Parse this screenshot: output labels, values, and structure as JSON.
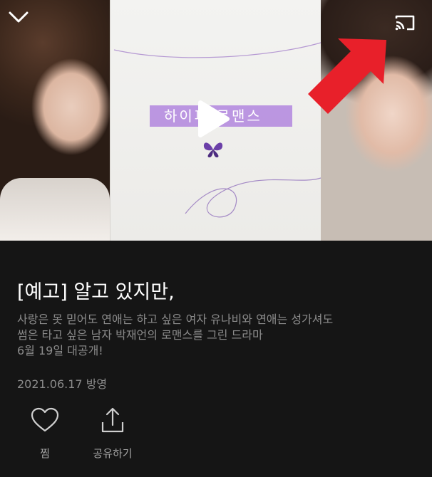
{
  "video": {
    "thumbnail_logo_text": "하이퍼 로맨스",
    "icons": {
      "collapse": "chevron-down-icon",
      "cast": "cast-icon",
      "play": "play-icon",
      "annotation": "red-arrow-icon"
    },
    "annotation_color": "#e8202a"
  },
  "info": {
    "title": "[예고] 알고 있지만,",
    "description_lines": [
      "사랑은 못 믿어도 연애는 하고 싶은 여자 유나비와 연애는 성가셔도",
      "썸은 타고 싶은 남자 박재언의 로맨스를 그린 드라마",
      "6월 19일 대공개!"
    ],
    "date": "2021.06.17 방영"
  },
  "actions": {
    "like": {
      "label": "찜",
      "icon": "heart-icon"
    },
    "share": {
      "label": "공유하기",
      "icon": "share-icon"
    }
  }
}
